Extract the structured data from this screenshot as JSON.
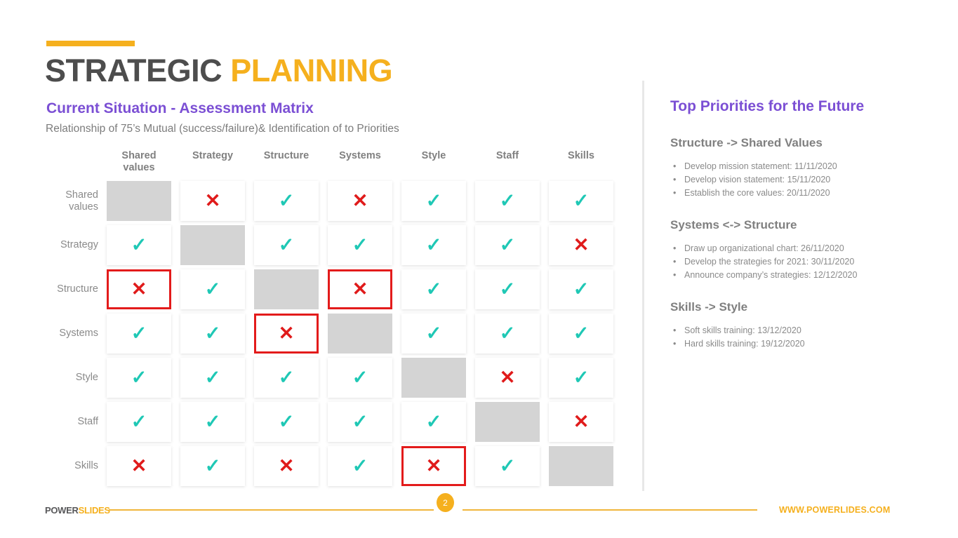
{
  "header": {
    "title_part1": "STRATEGIC",
    "title_part2": "PLANNING",
    "section_title": "Current Situation - Assessment Matrix",
    "section_subtitle": "Relationship of 75’s Mutual (success/failure)& Identification of to Priorities"
  },
  "colors": {
    "accent_amber": "#f5b01e",
    "purple": "#7b4fd4",
    "check_teal": "#1fc8b5",
    "cross_red": "#e01b1b",
    "highlight_red": "#e31b1b",
    "blank_gray": "#d4d4d4",
    "text_gray": "#808080",
    "title_dark": "#4d4d4d"
  },
  "matrix": {
    "columns": [
      "Shared values",
      "Strategy",
      "Structure",
      "Systems",
      "Style",
      "Staff",
      "Skills"
    ],
    "rows": [
      {
        "label": "Shared values",
        "cells": [
          {
            "type": "blank",
            "glyph": "",
            "highlight": false
          },
          {
            "type": "cross",
            "glyph": "✕",
            "highlight": false
          },
          {
            "type": "check",
            "glyph": "✓",
            "highlight": false
          },
          {
            "type": "cross",
            "glyph": "✕",
            "highlight": false
          },
          {
            "type": "check",
            "glyph": "✓",
            "highlight": false
          },
          {
            "type": "check",
            "glyph": "✓",
            "highlight": false
          },
          {
            "type": "check",
            "glyph": "✓",
            "highlight": false
          }
        ]
      },
      {
        "label": "Strategy",
        "cells": [
          {
            "type": "check",
            "glyph": "✓",
            "highlight": false
          },
          {
            "type": "blank",
            "glyph": "",
            "highlight": false
          },
          {
            "type": "check",
            "glyph": "✓",
            "highlight": false
          },
          {
            "type": "check",
            "glyph": "✓",
            "highlight": false
          },
          {
            "type": "check",
            "glyph": "✓",
            "highlight": false
          },
          {
            "type": "check",
            "glyph": "✓",
            "highlight": false
          },
          {
            "type": "cross",
            "glyph": "✕",
            "highlight": false
          }
        ]
      },
      {
        "label": "Structure",
        "cells": [
          {
            "type": "cross",
            "glyph": "✕",
            "highlight": true
          },
          {
            "type": "check",
            "glyph": "✓",
            "highlight": false
          },
          {
            "type": "blank",
            "glyph": "",
            "highlight": false
          },
          {
            "type": "cross",
            "glyph": "✕",
            "highlight": true
          },
          {
            "type": "check",
            "glyph": "✓",
            "highlight": false
          },
          {
            "type": "check",
            "glyph": "✓",
            "highlight": false
          },
          {
            "type": "check",
            "glyph": "✓",
            "highlight": false
          }
        ]
      },
      {
        "label": "Systems",
        "cells": [
          {
            "type": "check",
            "glyph": "✓",
            "highlight": false
          },
          {
            "type": "check",
            "glyph": "✓",
            "highlight": false
          },
          {
            "type": "cross",
            "glyph": "✕",
            "highlight": true
          },
          {
            "type": "blank",
            "glyph": "",
            "highlight": false
          },
          {
            "type": "check",
            "glyph": "✓",
            "highlight": false
          },
          {
            "type": "check",
            "glyph": "✓",
            "highlight": false
          },
          {
            "type": "check",
            "glyph": "✓",
            "highlight": false
          }
        ]
      },
      {
        "label": "Style",
        "cells": [
          {
            "type": "check",
            "glyph": "✓",
            "highlight": false
          },
          {
            "type": "check",
            "glyph": "✓",
            "highlight": false
          },
          {
            "type": "check",
            "glyph": "✓",
            "highlight": false
          },
          {
            "type": "check",
            "glyph": "✓",
            "highlight": false
          },
          {
            "type": "blank",
            "glyph": "",
            "highlight": false
          },
          {
            "type": "cross",
            "glyph": "✕",
            "highlight": false
          },
          {
            "type": "check",
            "glyph": "✓",
            "highlight": false
          }
        ]
      },
      {
        "label": "Staff",
        "cells": [
          {
            "type": "check",
            "glyph": "✓",
            "highlight": false
          },
          {
            "type": "check",
            "glyph": "✓",
            "highlight": false
          },
          {
            "type": "check",
            "glyph": "✓",
            "highlight": false
          },
          {
            "type": "check",
            "glyph": "✓",
            "highlight": false
          },
          {
            "type": "check",
            "glyph": "✓",
            "highlight": false
          },
          {
            "type": "blank",
            "glyph": "",
            "highlight": false
          },
          {
            "type": "cross",
            "glyph": "✕",
            "highlight": false
          }
        ]
      },
      {
        "label": "Skills",
        "cells": [
          {
            "type": "cross",
            "glyph": "✕",
            "highlight": false
          },
          {
            "type": "check",
            "glyph": "✓",
            "highlight": false
          },
          {
            "type": "cross",
            "glyph": "✕",
            "highlight": false
          },
          {
            "type": "check",
            "glyph": "✓",
            "highlight": false
          },
          {
            "type": "cross",
            "glyph": "✕",
            "highlight": true
          },
          {
            "type": "check",
            "glyph": "✓",
            "highlight": false
          },
          {
            "type": "blank",
            "glyph": "",
            "highlight": false
          }
        ]
      }
    ]
  },
  "priorities": {
    "title": "Top Priorities for the Future",
    "groups": [
      {
        "heading": "Structure -> Shared Values",
        "items": [
          "Develop mission statement: 11/11/2020",
          "Develop vision statement: 15/11/2020",
          "Establish the core values: 20/11/2020"
        ]
      },
      {
        "heading": "Systems <-> Structure",
        "items": [
          "Draw up organizational chart: 26/11/2020",
          "Develop the strategies for 2021: 30/11/2020",
          "Announce company’s strategies: 12/12/2020"
        ]
      },
      {
        "heading": "Skills -> Style",
        "items": [
          "Soft skills training: 13/12/2020",
          "Hard skills training: 19/12/2020"
        ]
      }
    ]
  },
  "footer": {
    "brand_part1": "POWER",
    "brand_part2": "SLIDES",
    "page_number": "2",
    "site_url": "WWW.POWERLIDES.COM"
  }
}
